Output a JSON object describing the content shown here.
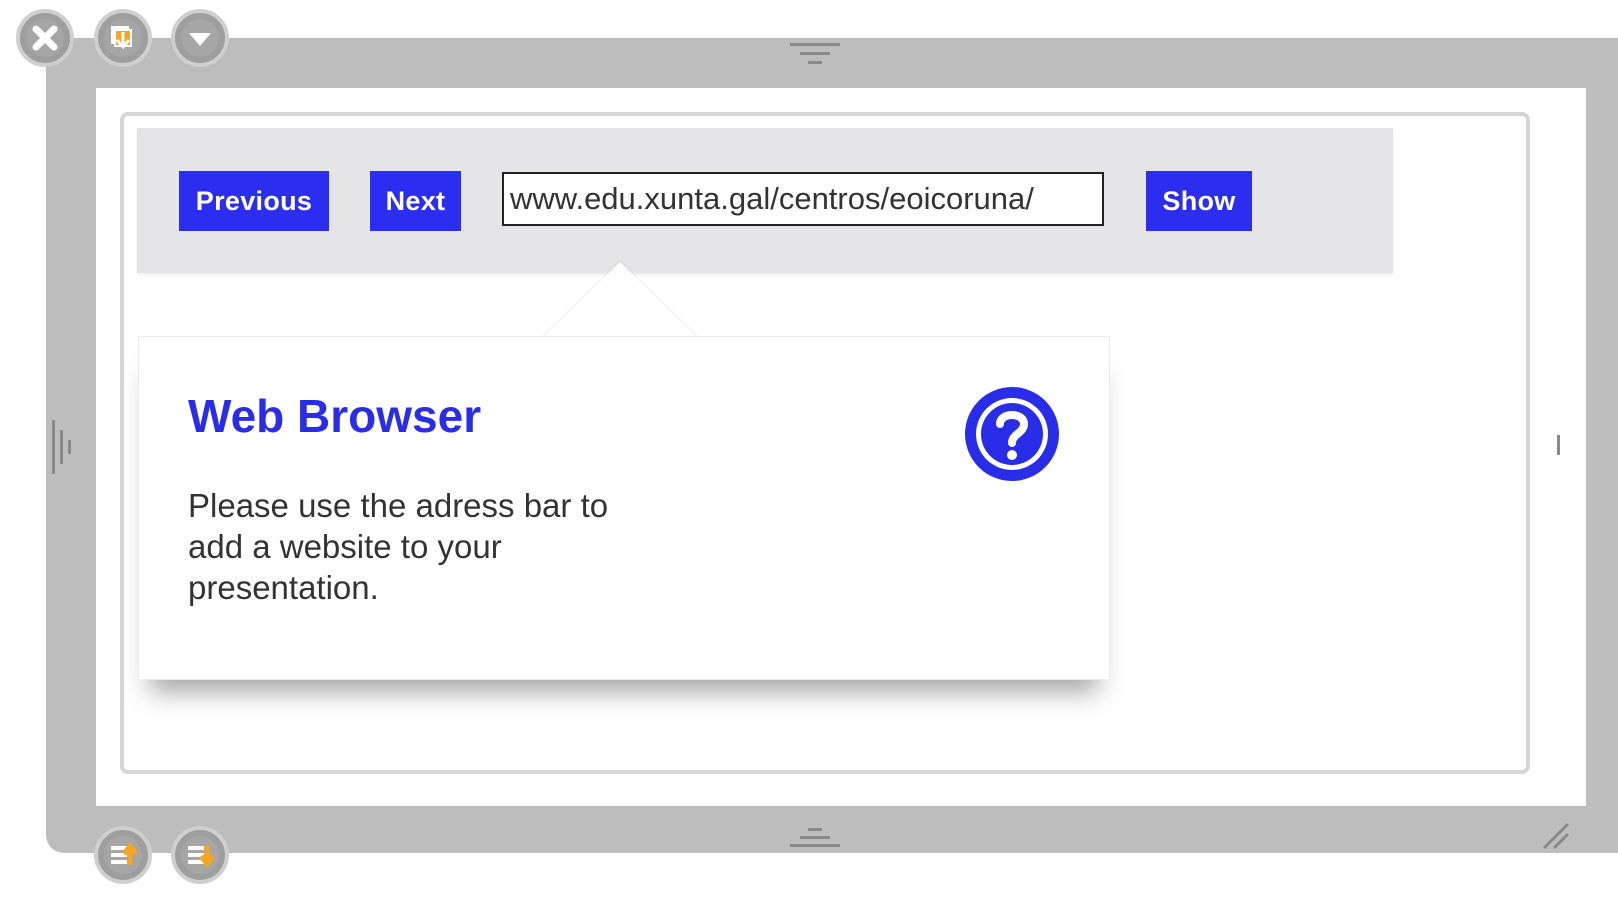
{
  "window": {
    "controls_top": [
      {
        "name": "close-icon",
        "label": "Close"
      },
      {
        "name": "bring-front-icon",
        "label": "Bring to front"
      },
      {
        "name": "collapse-icon",
        "label": "Collapse"
      }
    ],
    "controls_bottom": [
      {
        "name": "move-up-icon",
        "label": "Move layer up"
      },
      {
        "name": "move-down-icon",
        "label": "Move layer down"
      }
    ]
  },
  "toolbar": {
    "previous_label": "Previous",
    "next_label": "Next",
    "url_value": "www.edu.xunta.gal/centros/eoicoruna/",
    "show_label": "Show"
  },
  "tooltip": {
    "title": "Web Browser",
    "body": "Please use the adress bar to add a website to your presentation.",
    "icon": "question-circle-icon"
  },
  "colors": {
    "accent": "#2b2ef0",
    "frame": "#bdbdbd",
    "toolbar_bg": "#e5e5e7",
    "text": "#333333",
    "control_orange": "#f5a623"
  }
}
